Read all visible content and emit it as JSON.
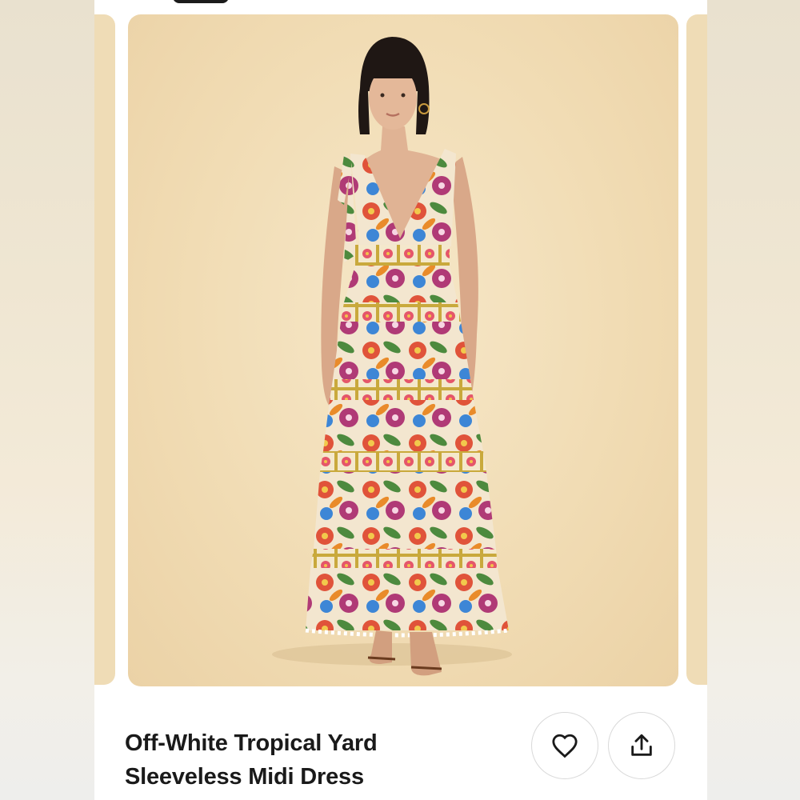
{
  "product": {
    "title_line1": "Off-White Tropical Yard",
    "title_line2": "Sleeveless Midi Dress",
    "image_icon": "product-photo-model-floral-dress"
  },
  "actions": {
    "like_icon": "heart-icon",
    "share_icon": "share-icon"
  },
  "colors": {
    "backdrop": "#f1dcb4",
    "title_text": "#1a1a1a",
    "button_border": "#d9d9d9"
  }
}
